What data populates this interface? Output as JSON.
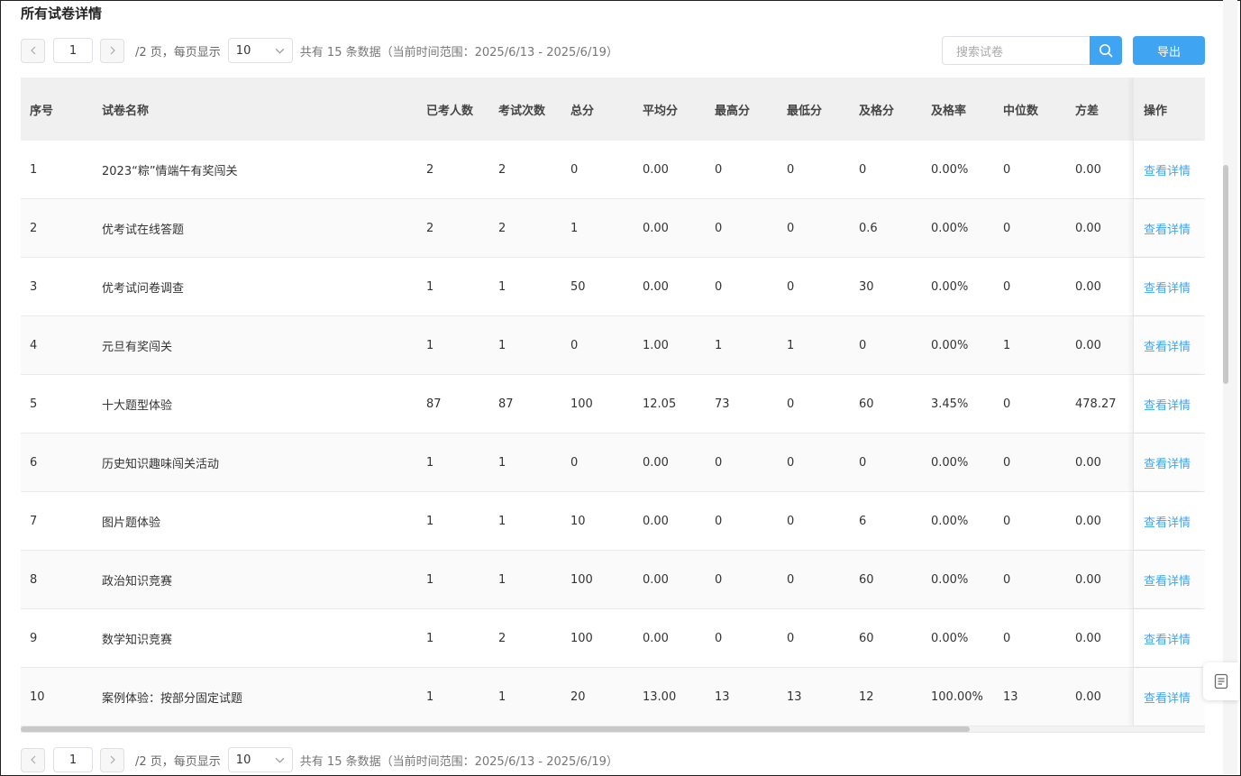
{
  "page": {
    "title": "所有试卷详情"
  },
  "pagination": {
    "current_page": "1",
    "pages_text": "/2 页，每页显示",
    "page_size": "10",
    "total_text": "共有 15 条数据（当前时间范围：2025/6/13 - 2025/6/19）"
  },
  "search": {
    "placeholder": "搜索试卷"
  },
  "toolbar": {
    "export_label": "导出"
  },
  "table": {
    "headers": {
      "idx": "序号",
      "name": "试卷名称",
      "takers": "已考人数",
      "times": "考试次数",
      "total": "总分",
      "avg": "平均分",
      "max": "最高分",
      "min": "最低分",
      "pass": "及格分",
      "rate": "及格率",
      "median": "中位数",
      "var": "方差",
      "op": "操作"
    },
    "rows": [
      {
        "idx": "1",
        "name": "2023“粽”情端午有奖闯关",
        "takers": "2",
        "times": "2",
        "total": "0",
        "avg": "0.00",
        "max": "0",
        "min": "0",
        "pass": "0",
        "rate": "0.00%",
        "median": "0",
        "var": "0.00",
        "op": "查看详情"
      },
      {
        "idx": "2",
        "name": "优考试在线答题",
        "takers": "2",
        "times": "2",
        "total": "1",
        "avg": "0.00",
        "max": "0",
        "min": "0",
        "pass": "0.6",
        "rate": "0.00%",
        "median": "0",
        "var": "0.00",
        "op": "查看详情"
      },
      {
        "idx": "3",
        "name": "优考试问卷调查",
        "takers": "1",
        "times": "1",
        "total": "50",
        "avg": "0.00",
        "max": "0",
        "min": "0",
        "pass": "30",
        "rate": "0.00%",
        "median": "0",
        "var": "0.00",
        "op": "查看详情"
      },
      {
        "idx": "4",
        "name": "元旦有奖闯关",
        "takers": "1",
        "times": "1",
        "total": "0",
        "avg": "1.00",
        "max": "1",
        "min": "1",
        "pass": "0",
        "rate": "0.00%",
        "median": "1",
        "var": "0.00",
        "op": "查看详情"
      },
      {
        "idx": "5",
        "name": "十大题型体验",
        "takers": "87",
        "times": "87",
        "total": "100",
        "avg": "12.05",
        "max": "73",
        "min": "0",
        "pass": "60",
        "rate": "3.45%",
        "median": "0",
        "var": "478.27",
        "op": "查看详情"
      },
      {
        "idx": "6",
        "name": "历史知识趣味闯关活动",
        "takers": "1",
        "times": "1",
        "total": "0",
        "avg": "0.00",
        "max": "0",
        "min": "0",
        "pass": "0",
        "rate": "0.00%",
        "median": "0",
        "var": "0.00",
        "op": "查看详情"
      },
      {
        "idx": "7",
        "name": "图片题体验",
        "takers": "1",
        "times": "1",
        "total": "10",
        "avg": "0.00",
        "max": "0",
        "min": "0",
        "pass": "6",
        "rate": "0.00%",
        "median": "0",
        "var": "0.00",
        "op": "查看详情"
      },
      {
        "idx": "8",
        "name": "政治知识竞赛",
        "takers": "1",
        "times": "1",
        "total": "100",
        "avg": "0.00",
        "max": "0",
        "min": "0",
        "pass": "60",
        "rate": "0.00%",
        "median": "0",
        "var": "0.00",
        "op": "查看详情"
      },
      {
        "idx": "9",
        "name": "数学知识竞赛",
        "takers": "1",
        "times": "2",
        "total": "100",
        "avg": "0.00",
        "max": "0",
        "min": "0",
        "pass": "60",
        "rate": "0.00%",
        "median": "0",
        "var": "0.00",
        "op": "查看详情"
      },
      {
        "idx": "10",
        "name": "案例体验：按部分固定试题",
        "takers": "1",
        "times": "1",
        "total": "20",
        "avg": "13.00",
        "max": "13",
        "min": "13",
        "pass": "12",
        "rate": "100.00%",
        "median": "13",
        "var": "0.00",
        "op": "查看详情"
      }
    ]
  },
  "colors": {
    "accent": "#3fa4f2",
    "header_bg": "#f0f0f0"
  },
  "icons": {
    "prev": "chevron-left-icon",
    "next": "chevron-right-icon",
    "dropdown": "chevron-down-icon",
    "search": "search-icon",
    "doc": "document-icon"
  }
}
